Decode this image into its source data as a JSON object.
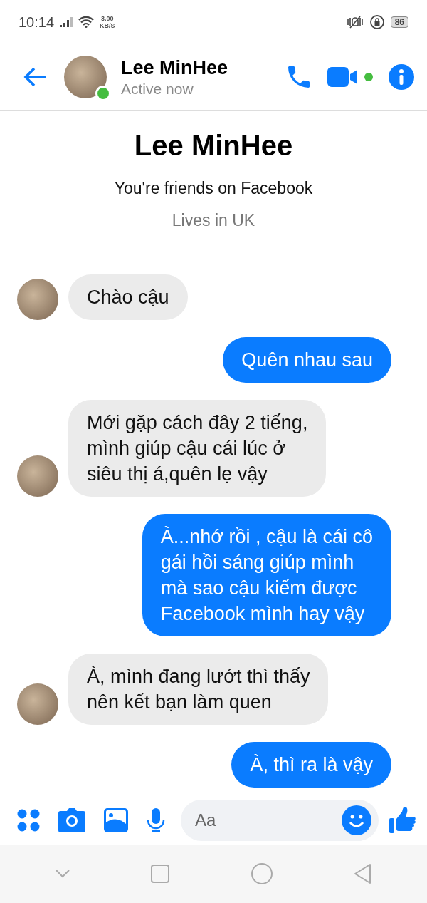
{
  "status_bar": {
    "time": "10:14",
    "speed": "3.00",
    "speed_unit": "KB/S",
    "battery": "86"
  },
  "header": {
    "name": "Lee MinHee",
    "status": "Active now",
    "online": true
  },
  "intro": {
    "name": "Lee MinHee",
    "friends": "You're friends on Facebook",
    "location": "Lives in UK"
  },
  "messages": [
    {
      "kind": "received",
      "text": "Chào cậu"
    },
    {
      "kind": "sent",
      "text": "Quên nhau sau"
    },
    {
      "kind": "received",
      "text": "Mới gặp cách đây 2 tiếng,\nmình giúp cậu cái lúc ở\nsiêu thị á,quên lẹ vậy"
    },
    {
      "kind": "sent",
      "text": "À...nhớ rồi , cậu là cái cô\ngái hồi sáng giúp mình\nmà sao cậu kiếm được\nFacebook mình hay vậy"
    },
    {
      "kind": "received",
      "text": "À, mình đang lướt thì thấy\nnên kết bạn làm quen"
    },
    {
      "kind": "sent",
      "text": "À, thì ra là vậy"
    }
  ],
  "composer": {
    "placeholder": "Aa"
  }
}
